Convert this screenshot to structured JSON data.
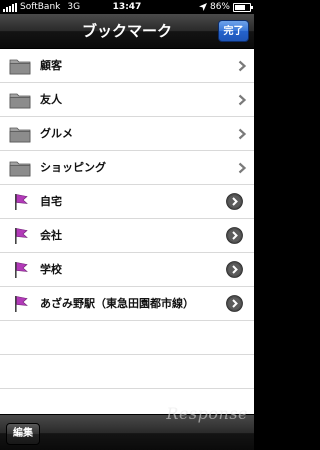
{
  "status_bar": {
    "carrier": "SoftBank",
    "network": "3G",
    "time": "13:47",
    "battery": "86%",
    "battery_level": 0.86
  },
  "nav": {
    "title": "ブックマーク",
    "done_label": "完了"
  },
  "folders": [
    {
      "label": "顧客",
      "icon": "folder-icon"
    },
    {
      "label": "友人",
      "icon": "folder-icon"
    },
    {
      "label": "グルメ",
      "icon": "folder-icon"
    },
    {
      "label": "ショッピング",
      "icon": "folder-icon"
    }
  ],
  "bookmarks": [
    {
      "label": "自宅",
      "icon": "pin-flag-icon"
    },
    {
      "label": "会社",
      "icon": "pin-flag-icon"
    },
    {
      "label": "学校",
      "icon": "pin-flag-icon"
    },
    {
      "label": "あざみ野駅（東急田園都市線）",
      "icon": "pin-flag-icon"
    }
  ],
  "toolbar": {
    "edit_label": "編集"
  },
  "watermark": "Response",
  "colors": {
    "flag": "#b23ab8",
    "done_button": "#2f6fd6"
  }
}
